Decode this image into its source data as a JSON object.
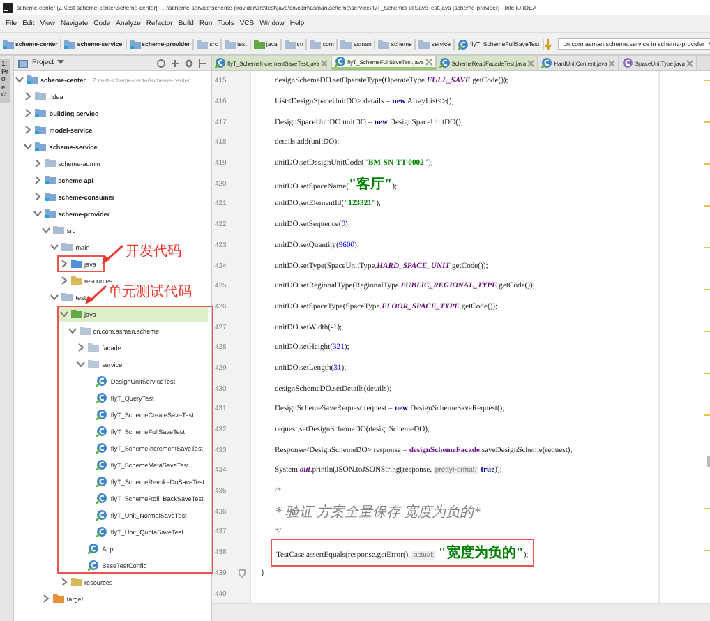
{
  "window": {
    "title": "scheme-center [Z:\\test-scheme-center\\scheme-center] - ...\\scheme-service\\scheme-provider\\src\\test\\java\\cn\\com\\asman\\scheme\\service\\flyT_SchemeFullSaveTest.java [scheme-provider] - IntelliJ IDEA"
  },
  "menu": [
    "File",
    "Edit",
    "View",
    "Navigate",
    "Code",
    "Analyze",
    "Refactor",
    "Build",
    "Run",
    "Tools",
    "VCS",
    "Window",
    "Help"
  ],
  "breadcrumbs": [
    {
      "label": "scheme-center",
      "kind": "module"
    },
    {
      "label": "scheme-service",
      "kind": "module"
    },
    {
      "label": "scheme-provider",
      "kind": "module"
    },
    {
      "label": "src",
      "kind": "folder"
    },
    {
      "label": "test",
      "kind": "folder"
    },
    {
      "label": "java",
      "kind": "test-source"
    },
    {
      "label": "cn",
      "kind": "folder"
    },
    {
      "label": "com",
      "kind": "folder"
    },
    {
      "label": "asman",
      "kind": "folder"
    },
    {
      "label": "scheme",
      "kind": "folder"
    },
    {
      "label": "service",
      "kind": "folder"
    },
    {
      "label": "flyT_SchemeFullSaveTest",
      "kind": "test-class"
    }
  ],
  "run_config": {
    "value": "cn.com.asman.scheme.service in scheme-provider"
  },
  "side_strip": {
    "label": "1: Project"
  },
  "project_panel": {
    "title": "Project",
    "tree": [
      {
        "name": "scheme-center",
        "kind": "module",
        "path": "Z:\\test-scheme-center\\scheme-center",
        "expanded": true,
        "selected": false,
        "children": [
          {
            "name": ".idea",
            "kind": "folder",
            "expanded": false,
            "selected": false
          },
          {
            "name": "building-service",
            "kind": "module",
            "expanded": false,
            "selected": false
          },
          {
            "name": "model-service",
            "kind": "module",
            "expanded": false,
            "selected": false
          },
          {
            "name": "scheme-service",
            "kind": "module",
            "expanded": true,
            "selected": false,
            "children": [
              {
                "name": "scheme-admin",
                "kind": "folder",
                "expanded": false,
                "selected": false
              },
              {
                "name": "scheme-api",
                "kind": "module",
                "expanded": false,
                "selected": false
              },
              {
                "name": "scheme-consumer",
                "kind": "module",
                "expanded": false,
                "selected": false
              },
              {
                "name": "scheme-provider",
                "kind": "module",
                "expanded": true,
                "selected": false,
                "children": [
                  {
                    "name": "src",
                    "kind": "folder",
                    "expanded": true,
                    "selected": false,
                    "children": [
                      {
                        "name": "main",
                        "kind": "folder",
                        "expanded": true,
                        "selected": false,
                        "children": [
                          {
                            "name": "java",
                            "kind": "source",
                            "expanded": false,
                            "selected": false,
                            "callout": {
                              "text": "开发代码",
                              "kind": "side-note"
                            }
                          },
                          {
                            "name": "resources",
                            "kind": "resources",
                            "expanded": false,
                            "selected": false
                          }
                        ]
                      },
                      {
                        "name": "test",
                        "kind": "folder",
                        "expanded": true,
                        "selected": false,
                        "children": [
                          {
                            "name": "java",
                            "kind": "test-source",
                            "expanded": true,
                            "selected": true,
                            "callout": {
                              "text": "单元测试代码",
                              "kind": "top-note"
                            },
                            "children": [
                              {
                                "name": "cn.com.asman.scheme",
                                "kind": "package",
                                "expanded": true,
                                "selected": false,
                                "children": [
                                  {
                                    "name": "facade",
                                    "kind": "package",
                                    "expanded": false,
                                    "selected": false
                                  },
                                  {
                                    "name": "service",
                                    "kind": "package",
                                    "expanded": true,
                                    "selected": false,
                                    "children": [
                                      {
                                        "name": "DesignUnitServiceTest",
                                        "kind": "class",
                                        "selected": false
                                      },
                                      {
                                        "name": "flyT_QueryTest",
                                        "kind": "class",
                                        "selected": false
                                      },
                                      {
                                        "name": "flyT_SchemeCreateSaveTest",
                                        "kind": "class",
                                        "selected": false
                                      },
                                      {
                                        "name": "flyT_SchemeFullSaveTest",
                                        "kind": "class",
                                        "selected": false
                                      },
                                      {
                                        "name": "flyT_SchemeIncrementSaveTest",
                                        "kind": "class",
                                        "selected": false
                                      },
                                      {
                                        "name": "flyT_SchemeMetaSaveTest",
                                        "kind": "class",
                                        "selected": false
                                      },
                                      {
                                        "name": "flyT_SchemeRevokeDoSaveTest",
                                        "kind": "class",
                                        "selected": false
                                      },
                                      {
                                        "name": "flyT_SchemeRoll_BackSaveTest",
                                        "kind": "class",
                                        "selected": false
                                      },
                                      {
                                        "name": "flyT_Unit_NormalSaveTest",
                                        "kind": "class",
                                        "selected": false
                                      },
                                      {
                                        "name": "flyT_Unit_QuotaSaveTest",
                                        "kind": "class",
                                        "selected": false
                                      }
                                    ]
                                  },
                                  {
                                    "name": "App",
                                    "kind": "class",
                                    "selected": false
                                  },
                                  {
                                    "name": "BaseTestConfig",
                                    "kind": "class",
                                    "selected": false
                                  }
                                ]
                              }
                            ]
                          },
                          {
                            "name": "resources",
                            "kind": "resources",
                            "expanded": false,
                            "selected": false
                          }
                        ]
                      }
                    ]
                  },
                  {
                    "name": "target",
                    "kind": "excluded",
                    "expanded": false,
                    "selected": false
                  }
                ]
              }
            ]
          }
        ]
      }
    ]
  },
  "tabs": [
    {
      "label": "flyT_SchemeIncrementSaveTest.java",
      "kind": "test-class",
      "selected": false
    },
    {
      "label": "flyT_SchemeFullSaveTest.java",
      "kind": "test-class",
      "selected": true
    },
    {
      "label": "SchemeReadFacadeTest.java",
      "kind": "test-class",
      "selected": false
    },
    {
      "label": "HardUnitContent.java",
      "kind": "class",
      "selected": false
    },
    {
      "label": "SpaceUnitType.java",
      "kind": "enum",
      "selected": false
    }
  ],
  "code": [
    {
      "number": "415",
      "kind": "code",
      "boxed": false,
      "segments": [
        {
          "kind": "plain",
          "text": "designSchemeDO.setOperateType(OperateType."
        },
        {
          "kind": "const",
          "text": "FULL_SAVE"
        },
        {
          "kind": "plain",
          "text": ".getCode());"
        }
      ]
    },
    {
      "number": "416",
      "kind": "code",
      "boxed": false,
      "segments": [
        {
          "kind": "plain",
          "text": "List<DesignSpaceUnitDO> details = "
        },
        {
          "kind": "keyword",
          "text": "new"
        },
        {
          "kind": "plain",
          "text": " ArrayList<>();"
        }
      ]
    },
    {
      "number": "417",
      "kind": "code",
      "boxed": false,
      "segments": [
        {
          "kind": "plain",
          "text": "DesignSpaceUnitDO unitDO = "
        },
        {
          "kind": "keyword",
          "text": "new"
        },
        {
          "kind": "plain",
          "text": " DesignSpaceUnitDO();"
        }
      ]
    },
    {
      "number": "418",
      "kind": "code",
      "boxed": false,
      "segments": [
        {
          "kind": "plain",
          "text": "details.add(unitDO);"
        }
      ]
    },
    {
      "number": "419",
      "kind": "code",
      "boxed": false,
      "segments": [
        {
          "kind": "plain",
          "text": "unitDO.setDesignUnitCode("
        },
        {
          "kind": "string",
          "text": "\"BM-SN-TT-0002\""
        },
        {
          "kind": "plain",
          "text": ");"
        }
      ]
    },
    {
      "number": "420",
      "kind": "code",
      "boxed": false,
      "segments": [
        {
          "kind": "plain",
          "text": "unitDO.setSpaceName("
        },
        {
          "kind": "string",
          "text": "\"客厅\""
        },
        {
          "kind": "plain",
          "text": ");"
        }
      ]
    },
    {
      "number": "421",
      "kind": "code",
      "boxed": false,
      "segments": [
        {
          "kind": "plain",
          "text": "unitDO.setElementId("
        },
        {
          "kind": "string",
          "text": "\"123321\""
        },
        {
          "kind": "plain",
          "text": ");"
        }
      ]
    },
    {
      "number": "422",
      "kind": "code",
      "boxed": false,
      "segments": [
        {
          "kind": "plain",
          "text": "unitDO.setSequence("
        },
        {
          "kind": "number",
          "text": "0"
        },
        {
          "kind": "plain",
          "text": ");"
        }
      ]
    },
    {
      "number": "423",
      "kind": "code",
      "boxed": false,
      "segments": [
        {
          "kind": "plain",
          "text": "unitDO.setQuantity("
        },
        {
          "kind": "number",
          "text": "9600"
        },
        {
          "kind": "plain",
          "text": ");"
        }
      ]
    },
    {
      "number": "424",
      "kind": "code",
      "boxed": false,
      "segments": [
        {
          "kind": "plain",
          "text": "unitDO.setType(SpaceUnitType."
        },
        {
          "kind": "const",
          "text": "HARD_SPACE_UNIT"
        },
        {
          "kind": "plain",
          "text": ".getCode());"
        }
      ]
    },
    {
      "number": "425",
      "kind": "code",
      "boxed": false,
      "segments": [
        {
          "kind": "plain",
          "text": "unitDO.setRegionalType(RegionalType."
        },
        {
          "kind": "const",
          "text": "PUBLIC_REGIONAL_TYPE"
        },
        {
          "kind": "plain",
          "text": ".getCode());"
        }
      ]
    },
    {
      "number": "426",
      "kind": "code",
      "boxed": false,
      "segments": [
        {
          "kind": "plain",
          "text": "unitDO.setSpaceType(SpaceType."
        },
        {
          "kind": "const",
          "text": "FLOOR_SPACE_TYPE"
        },
        {
          "kind": "plain",
          "text": ".getCode());"
        }
      ]
    },
    {
      "number": "427",
      "kind": "code",
      "boxed": false,
      "segments": [
        {
          "kind": "plain",
          "text": "unitDO.setWidth("
        },
        {
          "kind": "number",
          "text": "-1"
        },
        {
          "kind": "plain",
          "text": ");"
        }
      ]
    },
    {
      "number": "428",
      "kind": "code",
      "boxed": false,
      "segments": [
        {
          "kind": "plain",
          "text": "unitDO.setHeight("
        },
        {
          "kind": "number",
          "text": "321"
        },
        {
          "kind": "plain",
          "text": ");"
        }
      ]
    },
    {
      "number": "429",
      "kind": "code",
      "boxed": false,
      "segments": [
        {
          "kind": "plain",
          "text": "unitDO.setLength("
        },
        {
          "kind": "number",
          "text": "31"
        },
        {
          "kind": "plain",
          "text": ");"
        }
      ]
    },
    {
      "number": "430",
      "kind": "code",
      "boxed": false,
      "segments": [
        {
          "kind": "plain",
          "text": "designSchemeDO.setDetails(details);"
        }
      ]
    },
    {
      "number": "431",
      "kind": "code",
      "boxed": false,
      "segments": [
        {
          "kind": "plain",
          "text": "DesignSchemeSaveRequest request = "
        },
        {
          "kind": "keyword",
          "text": "new"
        },
        {
          "kind": "plain",
          "text": " DesignSchemeSaveRequest();"
        }
      ]
    },
    {
      "number": "432",
      "kind": "code",
      "boxed": false,
      "segments": [
        {
          "kind": "plain",
          "text": "request.setDesignSchemeDO(designSchemeDO);"
        }
      ]
    },
    {
      "number": "433",
      "kind": "code",
      "boxed": false,
      "segments": [
        {
          "kind": "plain",
          "text": "Response<DesignSchemeDO> response = "
        },
        {
          "kind": "field",
          "text": "designSchemeFacade"
        },
        {
          "kind": "plain",
          "text": ".saveDesignScheme(request);"
        }
      ]
    },
    {
      "number": "434",
      "kind": "code",
      "boxed": false,
      "segments": [
        {
          "kind": "plain",
          "text": "System."
        },
        {
          "kind": "const",
          "text": "out"
        },
        {
          "kind": "plain",
          "text": ".println(JSON.toJSONString(response, "
        },
        {
          "kind": "hint",
          "text": "prettyFormat:"
        },
        {
          "kind": "keyword",
          "text": "true"
        },
        {
          "kind": "plain",
          "text": "));"
        }
      ]
    },
    {
      "number": "435",
      "kind": "code",
      "boxed": false,
      "segments": [
        {
          "kind": "comment",
          "text": "/*"
        }
      ]
    },
    {
      "number": "436",
      "kind": "code",
      "boxed": false,
      "segments": [
        {
          "kind": "comment",
          "text": " * 验证 方案全量保存 宽度为负的*"
        }
      ]
    },
    {
      "number": "437",
      "kind": "code",
      "boxed": false,
      "segments": [
        {
          "kind": "comment",
          "text": " */"
        }
      ]
    },
    {
      "number": "438",
      "kind": "code",
      "boxed": true,
      "segments": [
        {
          "kind": "plain",
          "text": "TestCase.assertEquals(response.getError(), "
        },
        {
          "kind": "hint",
          "text": "actual:"
        },
        {
          "kind": "string",
          "text": "\"宽度为负的\""
        },
        {
          "kind": "plain",
          "text": ");"
        }
      ]
    },
    {
      "number": "439",
      "kind": "close",
      "boxed": false,
      "segments": [
        {
          "kind": "plain",
          "text": "}"
        }
      ]
    },
    {
      "number": "440",
      "kind": "code"
    }
  ]
}
